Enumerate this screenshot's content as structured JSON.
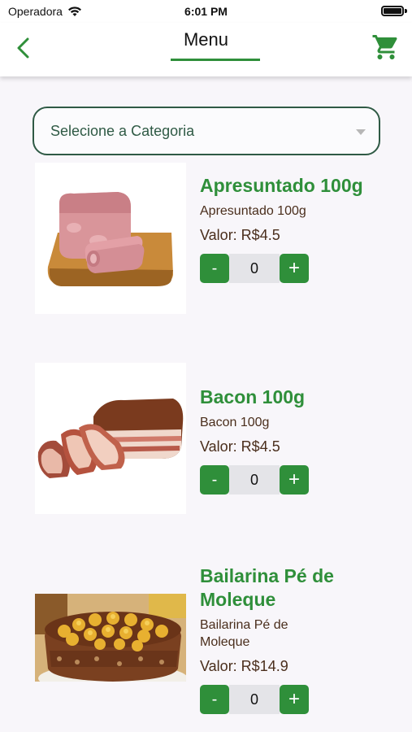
{
  "status_bar": {
    "carrier": "Operadora",
    "time": "6:01 PM"
  },
  "nav": {
    "title": "Menu",
    "back_icon": "chevron-left-icon",
    "cart_icon": "cart-icon"
  },
  "category": {
    "placeholder": "Selecione a Categoria"
  },
  "colors": {
    "accent": "#2f8f3a",
    "text": "#4a2e1c",
    "border": "#2f5a45"
  },
  "products": [
    {
      "name": "Apresuntado 100g",
      "description": "Apresuntado 100g",
      "price": "Valor: R$4.5",
      "quantity": "0",
      "image": "sliced-ham-image"
    },
    {
      "name": "Bacon 100g",
      "description": "Bacon 100g",
      "price": "Valor: R$4.5",
      "quantity": "0",
      "image": "bacon-image"
    },
    {
      "name": "Bailarina Pé de Moleque",
      "description": "Bailarina Pé de Moleque",
      "price": "Valor: R$14.9",
      "quantity": "0",
      "image": "cake-image"
    }
  ],
  "qty_controls": {
    "minus": "-",
    "plus": "+"
  }
}
